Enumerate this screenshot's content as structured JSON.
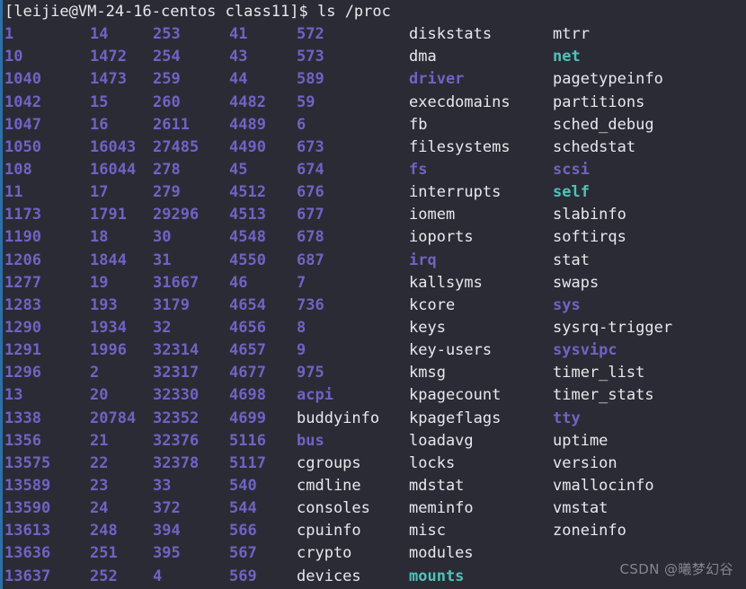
{
  "terminal": {
    "user": "leijie",
    "host": "VM-24-16-centos",
    "cwd": "class11",
    "prompt_line": "[leijie@VM-24-16-centos class11]$ ls /proc",
    "command": "ls /proc",
    "background_color": "#2b2b35",
    "left_stripe_color": "#2f6fa8",
    "colors": {
      "directory": "#6f63c4",
      "file": "#e8e8ec",
      "symlink": "#4ec3b8",
      "prompt_text": "#e8e8ec"
    }
  },
  "watermark": {
    "text": "CSDN @曦梦幻谷",
    "color": "#a8a8b4"
  },
  "listing": {
    "columns": 7,
    "rows": 25,
    "grid": [
      [
        {
          "name": "1",
          "type": "dir"
        },
        {
          "name": "14",
          "type": "dir"
        },
        {
          "name": "253",
          "type": "dir"
        },
        {
          "name": "41",
          "type": "dir"
        },
        {
          "name": "572",
          "type": "dir"
        },
        {
          "name": "diskstats",
          "type": "file"
        },
        {
          "name": "mtrr",
          "type": "file"
        }
      ],
      [
        {
          "name": "10",
          "type": "dir"
        },
        {
          "name": "1472",
          "type": "dir"
        },
        {
          "name": "254",
          "type": "dir"
        },
        {
          "name": "43",
          "type": "dir"
        },
        {
          "name": "573",
          "type": "dir"
        },
        {
          "name": "dma",
          "type": "file"
        },
        {
          "name": "net",
          "type": "link"
        }
      ],
      [
        {
          "name": "1040",
          "type": "dir"
        },
        {
          "name": "1473",
          "type": "dir"
        },
        {
          "name": "259",
          "type": "dir"
        },
        {
          "name": "44",
          "type": "dir"
        },
        {
          "name": "589",
          "type": "dir"
        },
        {
          "name": "driver",
          "type": "dir"
        },
        {
          "name": "pagetypeinfo",
          "type": "file"
        }
      ],
      [
        {
          "name": "1042",
          "type": "dir"
        },
        {
          "name": "15",
          "type": "dir"
        },
        {
          "name": "260",
          "type": "dir"
        },
        {
          "name": "4482",
          "type": "dir"
        },
        {
          "name": "59",
          "type": "dir"
        },
        {
          "name": "execdomains",
          "type": "file"
        },
        {
          "name": "partitions",
          "type": "file"
        }
      ],
      [
        {
          "name": "1047",
          "type": "dir"
        },
        {
          "name": "16",
          "type": "dir"
        },
        {
          "name": "2611",
          "type": "dir"
        },
        {
          "name": "4489",
          "type": "dir"
        },
        {
          "name": "6",
          "type": "dir"
        },
        {
          "name": "fb",
          "type": "file"
        },
        {
          "name": "sched_debug",
          "type": "file"
        }
      ],
      [
        {
          "name": "1050",
          "type": "dir"
        },
        {
          "name": "16043",
          "type": "dir"
        },
        {
          "name": "27485",
          "type": "dir"
        },
        {
          "name": "4490",
          "type": "dir"
        },
        {
          "name": "673",
          "type": "dir"
        },
        {
          "name": "filesystems",
          "type": "file"
        },
        {
          "name": "schedstat",
          "type": "file"
        }
      ],
      [
        {
          "name": "108",
          "type": "dir"
        },
        {
          "name": "16044",
          "type": "dir"
        },
        {
          "name": "278",
          "type": "dir"
        },
        {
          "name": "45",
          "type": "dir"
        },
        {
          "name": "674",
          "type": "dir"
        },
        {
          "name": "fs",
          "type": "dir"
        },
        {
          "name": "scsi",
          "type": "dir"
        }
      ],
      [
        {
          "name": "11",
          "type": "dir"
        },
        {
          "name": "17",
          "type": "dir"
        },
        {
          "name": "279",
          "type": "dir"
        },
        {
          "name": "4512",
          "type": "dir"
        },
        {
          "name": "676",
          "type": "dir"
        },
        {
          "name": "interrupts",
          "type": "file"
        },
        {
          "name": "self",
          "type": "link"
        }
      ],
      [
        {
          "name": "1173",
          "type": "dir"
        },
        {
          "name": "1791",
          "type": "dir"
        },
        {
          "name": "29296",
          "type": "dir"
        },
        {
          "name": "4513",
          "type": "dir"
        },
        {
          "name": "677",
          "type": "dir"
        },
        {
          "name": "iomem",
          "type": "file"
        },
        {
          "name": "slabinfo",
          "type": "file"
        }
      ],
      [
        {
          "name": "1190",
          "type": "dir"
        },
        {
          "name": "18",
          "type": "dir"
        },
        {
          "name": "30",
          "type": "dir"
        },
        {
          "name": "4548",
          "type": "dir"
        },
        {
          "name": "678",
          "type": "dir"
        },
        {
          "name": "ioports",
          "type": "file"
        },
        {
          "name": "softirqs",
          "type": "file"
        }
      ],
      [
        {
          "name": "1206",
          "type": "dir"
        },
        {
          "name": "1844",
          "type": "dir"
        },
        {
          "name": "31",
          "type": "dir"
        },
        {
          "name": "4550",
          "type": "dir"
        },
        {
          "name": "687",
          "type": "dir"
        },
        {
          "name": "irq",
          "type": "dir"
        },
        {
          "name": "stat",
          "type": "file"
        }
      ],
      [
        {
          "name": "1277",
          "type": "dir"
        },
        {
          "name": "19",
          "type": "dir"
        },
        {
          "name": "31667",
          "type": "dir"
        },
        {
          "name": "46",
          "type": "dir"
        },
        {
          "name": "7",
          "type": "dir"
        },
        {
          "name": "kallsyms",
          "type": "file"
        },
        {
          "name": "swaps",
          "type": "file"
        }
      ],
      [
        {
          "name": "1283",
          "type": "dir"
        },
        {
          "name": "193",
          "type": "dir"
        },
        {
          "name": "3179",
          "type": "dir"
        },
        {
          "name": "4654",
          "type": "dir"
        },
        {
          "name": "736",
          "type": "dir"
        },
        {
          "name": "kcore",
          "type": "file"
        },
        {
          "name": "sys",
          "type": "dir"
        }
      ],
      [
        {
          "name": "1290",
          "type": "dir"
        },
        {
          "name": "1934",
          "type": "dir"
        },
        {
          "name": "32",
          "type": "dir"
        },
        {
          "name": "4656",
          "type": "dir"
        },
        {
          "name": "8",
          "type": "dir"
        },
        {
          "name": "keys",
          "type": "file"
        },
        {
          "name": "sysrq-trigger",
          "type": "file"
        }
      ],
      [
        {
          "name": "1291",
          "type": "dir"
        },
        {
          "name": "1996",
          "type": "dir"
        },
        {
          "name": "32314",
          "type": "dir"
        },
        {
          "name": "4657",
          "type": "dir"
        },
        {
          "name": "9",
          "type": "dir"
        },
        {
          "name": "key-users",
          "type": "file"
        },
        {
          "name": "sysvipc",
          "type": "dir"
        }
      ],
      [
        {
          "name": "1296",
          "type": "dir"
        },
        {
          "name": "2",
          "type": "dir"
        },
        {
          "name": "32317",
          "type": "dir"
        },
        {
          "name": "4677",
          "type": "dir"
        },
        {
          "name": "975",
          "type": "dir"
        },
        {
          "name": "kmsg",
          "type": "file"
        },
        {
          "name": "timer_list",
          "type": "file"
        }
      ],
      [
        {
          "name": "13",
          "type": "dir"
        },
        {
          "name": "20",
          "type": "dir"
        },
        {
          "name": "32330",
          "type": "dir"
        },
        {
          "name": "4698",
          "type": "dir"
        },
        {
          "name": "acpi",
          "type": "dir"
        },
        {
          "name": "kpagecount",
          "type": "file"
        },
        {
          "name": "timer_stats",
          "type": "file"
        }
      ],
      [
        {
          "name": "1338",
          "type": "dir"
        },
        {
          "name": "20784",
          "type": "dir"
        },
        {
          "name": "32352",
          "type": "dir"
        },
        {
          "name": "4699",
          "type": "dir"
        },
        {
          "name": "buddyinfo",
          "type": "file"
        },
        {
          "name": "kpageflags",
          "type": "file"
        },
        {
          "name": "tty",
          "type": "dir"
        }
      ],
      [
        {
          "name": "1356",
          "type": "dir"
        },
        {
          "name": "21",
          "type": "dir"
        },
        {
          "name": "32376",
          "type": "dir"
        },
        {
          "name": "5116",
          "type": "dir"
        },
        {
          "name": "bus",
          "type": "dir"
        },
        {
          "name": "loadavg",
          "type": "file"
        },
        {
          "name": "uptime",
          "type": "file"
        }
      ],
      [
        {
          "name": "13575",
          "type": "dir"
        },
        {
          "name": "22",
          "type": "dir"
        },
        {
          "name": "32378",
          "type": "dir"
        },
        {
          "name": "5117",
          "type": "dir"
        },
        {
          "name": "cgroups",
          "type": "file"
        },
        {
          "name": "locks",
          "type": "file"
        },
        {
          "name": "version",
          "type": "file"
        }
      ],
      [
        {
          "name": "13589",
          "type": "dir"
        },
        {
          "name": "23",
          "type": "dir"
        },
        {
          "name": "33",
          "type": "dir"
        },
        {
          "name": "540",
          "type": "dir"
        },
        {
          "name": "cmdline",
          "type": "file"
        },
        {
          "name": "mdstat",
          "type": "file"
        },
        {
          "name": "vmallocinfo",
          "type": "file"
        }
      ],
      [
        {
          "name": "13590",
          "type": "dir"
        },
        {
          "name": "24",
          "type": "dir"
        },
        {
          "name": "372",
          "type": "dir"
        },
        {
          "name": "544",
          "type": "dir"
        },
        {
          "name": "consoles",
          "type": "file"
        },
        {
          "name": "meminfo",
          "type": "file"
        },
        {
          "name": "vmstat",
          "type": "file"
        }
      ],
      [
        {
          "name": "13613",
          "type": "dir"
        },
        {
          "name": "248",
          "type": "dir"
        },
        {
          "name": "394",
          "type": "dir"
        },
        {
          "name": "566",
          "type": "dir"
        },
        {
          "name": "cpuinfo",
          "type": "file"
        },
        {
          "name": "misc",
          "type": "file"
        },
        {
          "name": "zoneinfo",
          "type": "file"
        }
      ],
      [
        {
          "name": "13636",
          "type": "dir"
        },
        {
          "name": "251",
          "type": "dir"
        },
        {
          "name": "395",
          "type": "dir"
        },
        {
          "name": "567",
          "type": "dir"
        },
        {
          "name": "crypto",
          "type": "file"
        },
        {
          "name": "modules",
          "type": "file"
        },
        {
          "name": "",
          "type": "file"
        }
      ],
      [
        {
          "name": "13637",
          "type": "dir"
        },
        {
          "name": "252",
          "type": "dir"
        },
        {
          "name": "4",
          "type": "dir"
        },
        {
          "name": "569",
          "type": "dir"
        },
        {
          "name": "devices",
          "type": "file"
        },
        {
          "name": "mounts",
          "type": "link"
        },
        {
          "name": "",
          "type": "file"
        }
      ]
    ]
  }
}
